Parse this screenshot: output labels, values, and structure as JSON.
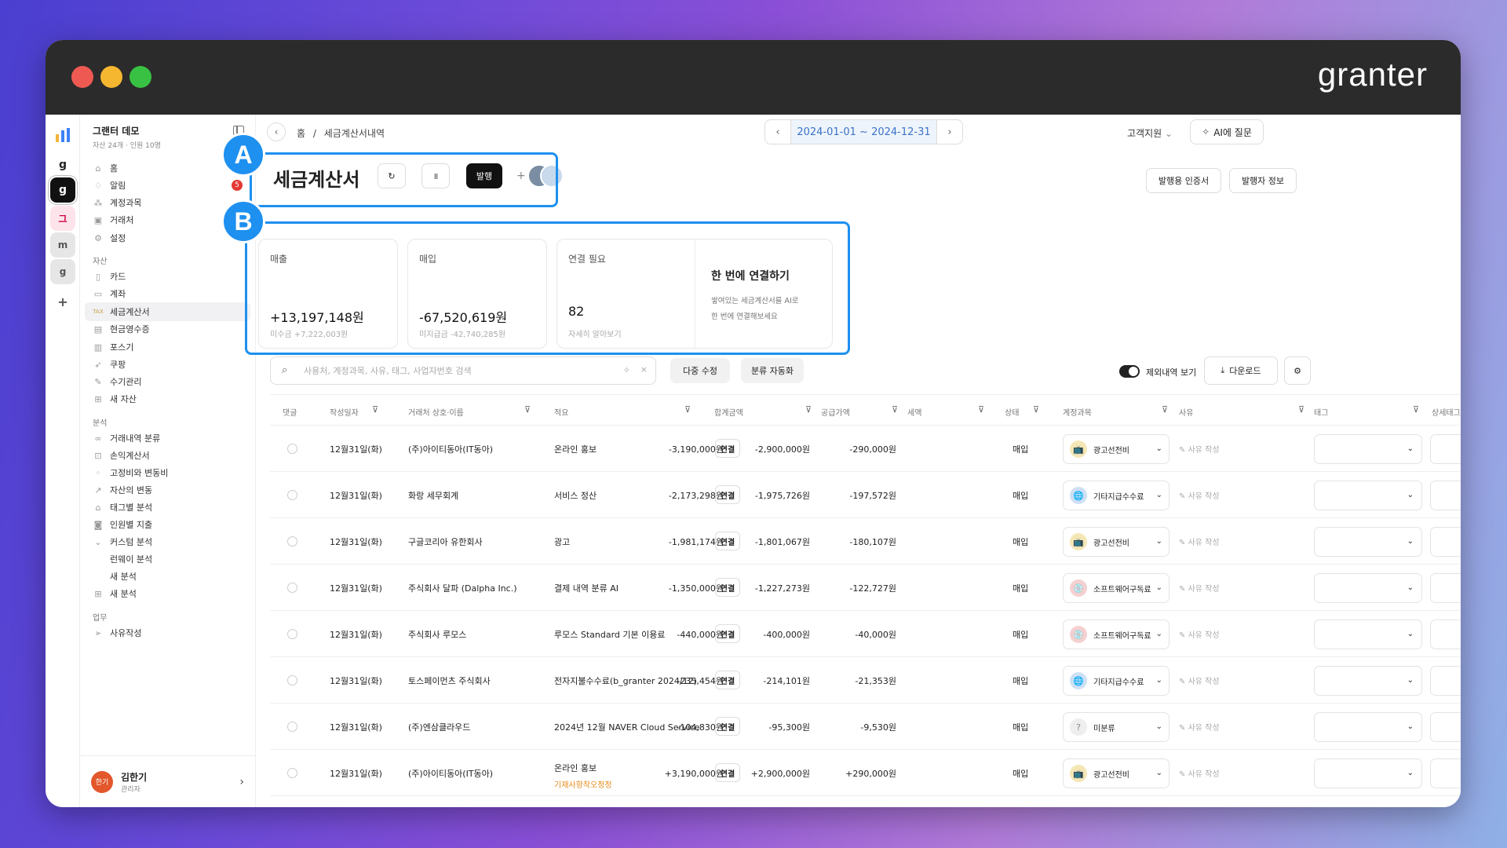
{
  "brand": "granter",
  "colors": {
    "accent": "#1e90f0",
    "date_text": "#3a73c9",
    "alert": "#e53935"
  },
  "workspace_rail": [
    "g",
    "g",
    "그",
    "m",
    "g",
    "+"
  ],
  "org": {
    "name": "그랜터 데모",
    "sub": "자산 24개 · 인원 10명"
  },
  "sidebar": {
    "top": [
      {
        "label": "홈",
        "icon": "home-icon"
      },
      {
        "label": "알림",
        "icon": "bell-icon",
        "badge": "5"
      },
      {
        "label": "계정과목",
        "icon": "tree-icon"
      },
      {
        "label": "거래처",
        "icon": "building-icon"
      },
      {
        "label": "설정",
        "icon": "gear-icon"
      }
    ],
    "asset_title": "자산",
    "asset": [
      {
        "label": "카드"
      },
      {
        "label": "계좌"
      },
      {
        "label": "세금계산서"
      },
      {
        "label": "현금영수증"
      },
      {
        "label": "포스기"
      },
      {
        "label": "쿠팡"
      },
      {
        "label": "수기관리"
      },
      {
        "label": "새 자산"
      }
    ],
    "analysis_title": "분석",
    "analysis": [
      {
        "label": "거래내역 분류"
      },
      {
        "label": "손익계산서"
      },
      {
        "label": "고정비와 변동비"
      },
      {
        "label": "자산의 변동"
      },
      {
        "label": "태그별 분석"
      },
      {
        "label": "인원별 지출"
      },
      {
        "label": "커스텀 분석"
      },
      {
        "label": "런웨이 분석"
      },
      {
        "label": "새 분석"
      },
      {
        "label": "새 분석"
      }
    ],
    "work_title": "업무",
    "work": [
      {
        "label": "사유작성"
      }
    ]
  },
  "user": {
    "avatar": "한기",
    "name": "김한기",
    "role": "관리자"
  },
  "topbar": {
    "home": "홈",
    "sep": "/",
    "page": "세금계산서내역",
    "date_range": "2024-01-01 ~ 2024-12-31",
    "support": "고객지원",
    "ai": "AI에 질문"
  },
  "header": {
    "title": "세금계산서",
    "issue": "발행",
    "cert": "발행용 인증서",
    "issuer": "발행자 정보"
  },
  "callouts": {
    "a": "A",
    "b": "B"
  },
  "cards": {
    "sales": {
      "label": "매출",
      "value": "+13,197,148원",
      "sub": "미수금 +7,222,003원"
    },
    "purchase": {
      "label": "매입",
      "value": "-67,520,619원",
      "sub": "미지급금 -42,740,285원"
    },
    "link": {
      "label": "연결 필요",
      "value": "82",
      "sub": "자세히 알아보기"
    },
    "promo": {
      "title": "한 번에 연결하기",
      "desc1": "쌓여있는 세금계산서를 AI로",
      "desc2": "한 번에 연결해보세요"
    }
  },
  "toolbar": {
    "search_placeholder": "사용처, 계정과목, 사유, 태그, 사업자번호 검색",
    "multi_edit": "다중 수정",
    "auto_classify": "분류 자동화",
    "exclude": "제외내역 보기",
    "download": "다운로드"
  },
  "columns": [
    "댓글",
    "작성일자",
    "거래처 상호·이름",
    "적요",
    "합계금액",
    "공급가액",
    "세액",
    "상태",
    "계정과목",
    "사유",
    "태그",
    "상세태그"
  ],
  "rows": [
    {
      "date": "12월31일(화)",
      "vendor": "(주)아이티동아(IT동아)",
      "memo": "온라인 홍보",
      "link": "연결",
      "total": "-3,190,000원",
      "supply": "-2,900,000원",
      "tax": "-290,000원",
      "status": "매입",
      "account": "광고선전비",
      "acc_icon": "📺",
      "acc_bg": "#f4e7b5",
      "reason": "사유 작성"
    },
    {
      "date": "12월31일(화)",
      "vendor": "화랑 세무회계",
      "memo": "서비스 정산",
      "link": "연결",
      "total": "-2,173,298원",
      "supply": "-1,975,726원",
      "tax": "-197,572원",
      "status": "매입",
      "account": "기타지급수수료",
      "acc_icon": "🌐",
      "acc_bg": "#cfe0f5",
      "reason": "사유 작성"
    },
    {
      "date": "12월31일(화)",
      "vendor": "구글코리아 유한회사",
      "memo": "광고",
      "link": "연결",
      "total": "-1,981,174원",
      "supply": "-1,801,067원",
      "tax": "-180,107원",
      "status": "매입",
      "account": "광고선전비",
      "acc_icon": "📺",
      "acc_bg": "#f4e7b5",
      "reason": "사유 작성"
    },
    {
      "date": "12월31일(화)",
      "vendor": "주식회사 달파 (Dalpha Inc.)",
      "memo": "결제 내역 분류 AI",
      "link": "연결",
      "total": "-1,350,000원",
      "supply": "-1,227,273원",
      "tax": "-122,727원",
      "status": "매입",
      "account": "소프트웨어구독료",
      "acc_icon": "💿",
      "acc_bg": "#f5d0d0",
      "reason": "사유 작성"
    },
    {
      "date": "12월31일(화)",
      "vendor": "주식회사 루모스",
      "memo": "루모스 Standard 기본 이용료",
      "link": "연결",
      "total": "-440,000원",
      "supply": "-400,000원",
      "tax": "-40,000원",
      "status": "매입",
      "account": "소프트웨어구독료",
      "acc_icon": "💿",
      "acc_bg": "#f5d0d0",
      "reason": "사유 작성"
    },
    {
      "date": "12월31일(화)",
      "vendor": "토스페이먼츠 주식회사",
      "memo": "전자지불수수료(b_granter 2024/12)",
      "link": "연결",
      "total": "-235,454원",
      "supply": "-214,101원",
      "tax": "-21,353원",
      "status": "매입",
      "account": "기타지급수수료",
      "acc_icon": "🌐",
      "acc_bg": "#cfe0f5",
      "reason": "사유 작성"
    },
    {
      "date": "12월31일(화)",
      "vendor": "(주)엔삼클라우드",
      "memo": "2024년 12월 NAVER Cloud Service",
      "link": "연결",
      "total": "-104,830원",
      "supply": "-95,300원",
      "tax": "-9,530원",
      "status": "매입",
      "account": "미분류",
      "acc_icon": "?",
      "acc_bg": "#eeeeee",
      "reason": "사유 작성"
    },
    {
      "date": "12월31일(화)",
      "vendor": "(주)아이티동아(IT동아)",
      "memo": "온라인 홍보",
      "memo2": "기재사항착오정정",
      "link": "연결",
      "total": "+3,190,000원",
      "supply": "+2,900,000원",
      "tax": "+290,000원",
      "status": "매입",
      "account": "광고선전비",
      "acc_icon": "📺",
      "acc_bg": "#f4e7b5",
      "reason": "사유 작성"
    }
  ]
}
